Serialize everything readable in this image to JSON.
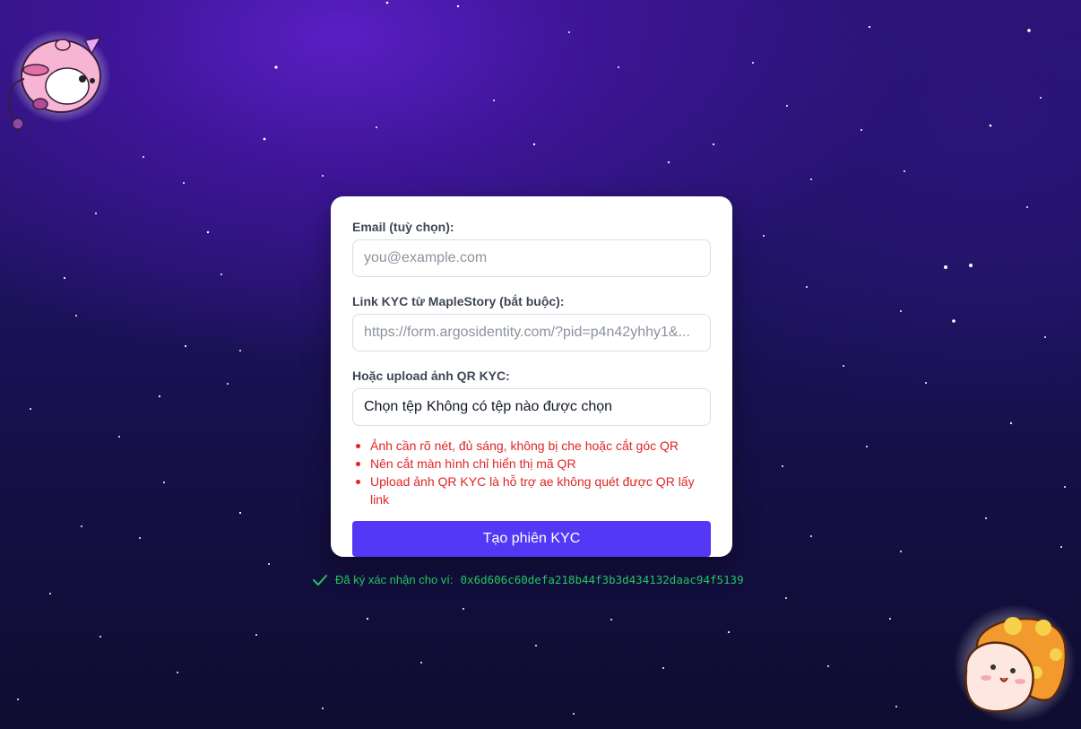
{
  "form": {
    "email_label": "Email (tuỳ chọn):",
    "email_placeholder": "you@example.com",
    "email_value": "",
    "link_label": "Link KYC từ MapleStory (bắt buộc):",
    "link_placeholder": "https://form.argosidentity.com/?pid=p4n42yhhy1&...",
    "link_value": "",
    "upload_label": "Hoặc upload ảnh QR KYC:",
    "file_button_label": "Chọn tệp",
    "file_status": "Không có tệp nào được chọn",
    "tips": [
      "Ảnh cần rõ nét, đủ sáng, không bị che hoặc cắt góc QR",
      "Nên cắt màn hình chỉ hiển thị mã QR",
      "Upload ảnh QR KYC là hỗ trợ ae không quét được QR lấy link"
    ],
    "submit_label": "Tạo phiên KYC"
  },
  "confirmation": {
    "icon": "check-icon",
    "text": "Đã ký xác nhận cho ví:",
    "wallet": "0x6d606c60defa218b44f3b3d434132daac94f5139"
  },
  "decorations": {
    "top_left": "pink-pig-balloon-mascot",
    "bottom_right": "orange-mushroom-mascot"
  },
  "colors": {
    "accent": "#5438f5",
    "error": "#e02424",
    "success": "#22c55e",
    "label": "#3f4755"
  }
}
